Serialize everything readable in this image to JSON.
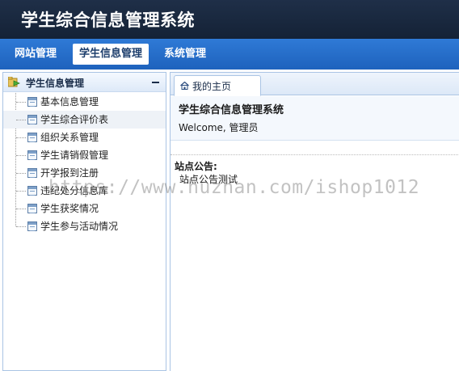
{
  "header": {
    "title": "学生综合信息管理系统"
  },
  "nav": {
    "items": [
      {
        "label": "网站管理"
      },
      {
        "label": "学生信息管理"
      },
      {
        "label": "系统管理"
      }
    ]
  },
  "sidebar": {
    "title": "学生信息管理",
    "items": [
      {
        "label": "基本信息管理"
      },
      {
        "label": "学生综合评价表"
      },
      {
        "label": "组织关系管理"
      },
      {
        "label": "学生请销假管理"
      },
      {
        "label": "开学报到注册"
      },
      {
        "label": "违纪处分信息库"
      },
      {
        "label": "学生获奖情况"
      },
      {
        "label": "学生参与活动情况"
      }
    ]
  },
  "main": {
    "tab": {
      "label": "我的主页"
    },
    "welcome_title": "学生综合信息管理系统",
    "welcome_text": "Welcome, 管理员",
    "notice_title": "站点公告:",
    "notice_text": "站点公告测试"
  },
  "watermark": "https://www.huzhan.com/ishop1012",
  "colors": {
    "header_bg": "#1a2a42",
    "nav_bg": "#2a72cf",
    "border": "#aac4e4"
  }
}
